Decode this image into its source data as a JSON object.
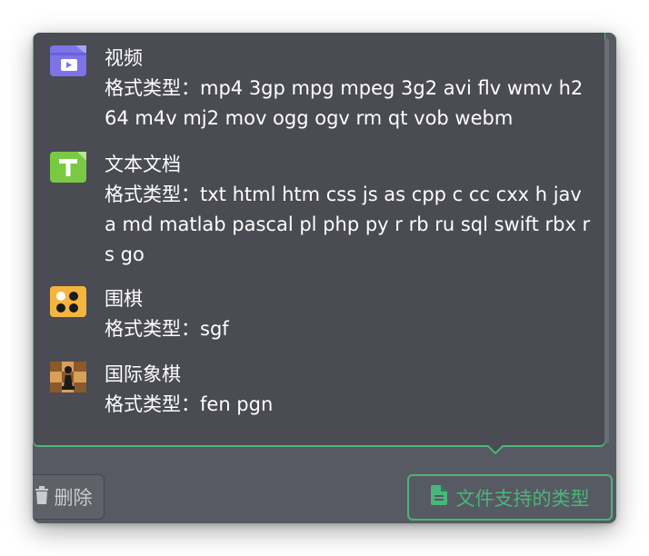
{
  "popover": {
    "items": [
      {
        "icon": "video-file-icon",
        "name": "视频",
        "formats": "格式类型：mp4 3gp mpg mpeg 3g2 avi flv wmv h264 m4v mj2 mov ogg ogv rm qt vob webm"
      },
      {
        "icon": "text-document-icon",
        "name": "文本文档",
        "formats": "格式类型：txt html htm css js as cpp c cc cxx h java md matlab pascal pl php py r rb ru sql swift rbx rs go"
      },
      {
        "icon": "go-board-icon",
        "name": "围棋",
        "formats": "格式类型：sgf"
      },
      {
        "icon": "chess-board-icon",
        "name": "国际象棋",
        "formats": "格式类型：fen pgn"
      }
    ]
  },
  "toolbar": {
    "delete_label": "删除",
    "supported_types_label": "文件支持的类型"
  },
  "colors": {
    "accent": "#4ab57a",
    "popover_bg": "#4a4b53",
    "panel_bg": "#575a62"
  }
}
